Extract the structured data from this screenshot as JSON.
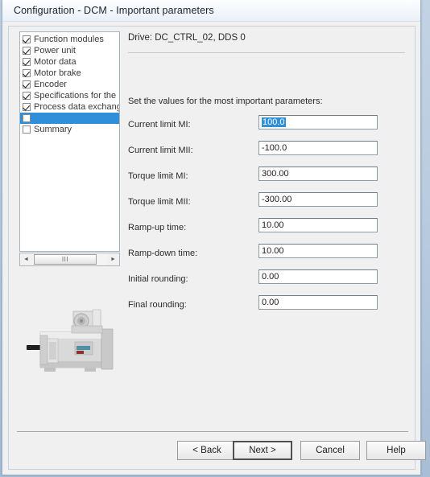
{
  "window": {
    "title": "Configuration - DCM - Important parameters"
  },
  "sidebar": {
    "items": [
      {
        "label": "Function modules",
        "checked": true,
        "selected": false
      },
      {
        "label": "Power unit",
        "checked": true,
        "selected": false
      },
      {
        "label": "Motor data",
        "checked": true,
        "selected": false
      },
      {
        "label": "Motor brake",
        "checked": true,
        "selected": false
      },
      {
        "label": "Encoder",
        "checked": true,
        "selected": false
      },
      {
        "label": "Specifications for the F",
        "checked": true,
        "selected": false
      },
      {
        "label": "Process data exchang",
        "checked": true,
        "selected": false
      },
      {
        "label": "",
        "checked": false,
        "selected": true
      },
      {
        "label": "Summary",
        "checked": false,
        "selected": false
      }
    ],
    "scrollbar": {
      "left_arrow": "◄",
      "right_arrow": "►",
      "thumb_grip": "III"
    },
    "image_alt": "dc-motor-photo"
  },
  "main": {
    "drive_header": "Drive: DC_CTRL_02, DDS 0",
    "intro": "Set the values for the most important parameters:",
    "fields": [
      {
        "label": "Current limit MI:",
        "value": "100.0",
        "selected": true
      },
      {
        "label": "Current limit MII:",
        "value": "-100.0",
        "selected": false
      },
      {
        "label": "Torque limit MI:",
        "value": "300.00",
        "selected": false
      },
      {
        "label": "Torque limit MII:",
        "value": "-300.00",
        "selected": false
      },
      {
        "label": "Ramp-up time:",
        "value": "10.00",
        "selected": false
      },
      {
        "label": "Ramp-down time:",
        "value": "10.00",
        "selected": false
      },
      {
        "label": "Initial rounding:",
        "value": "0.00",
        "selected": false
      },
      {
        "label": "Final rounding:",
        "value": "0.00",
        "selected": false
      }
    ]
  },
  "footer": {
    "buttons": [
      {
        "id": "back",
        "label": "< Back",
        "focused": false
      },
      {
        "id": "next",
        "label": "Next >",
        "focused": true
      },
      {
        "id": "cancel",
        "label": "Cancel",
        "focused": false
      },
      {
        "id": "help",
        "label": "Help",
        "focused": false
      }
    ]
  },
  "colors": {
    "selection_blue": "#2f8fd8",
    "desktop_blue": "#b9cbdf",
    "dialog_face": "#f0f0f0"
  }
}
